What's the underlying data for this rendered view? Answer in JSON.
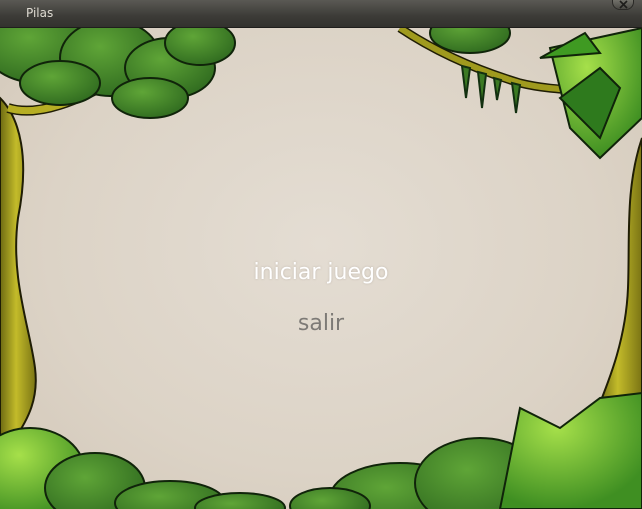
{
  "window": {
    "title": "Pilas",
    "close_icon": "close-icon"
  },
  "menu": {
    "items": [
      {
        "label": "iniciar juego",
        "selected": true,
        "color": "#ffffff"
      },
      {
        "label": "salir",
        "selected": false,
        "color": "#7d7a76"
      }
    ]
  },
  "colors": {
    "background": "#ddd5c9",
    "foliage_dark": "#2f6a1f",
    "foliage_light": "#7fc43a",
    "trunk": "#a8a21e"
  }
}
